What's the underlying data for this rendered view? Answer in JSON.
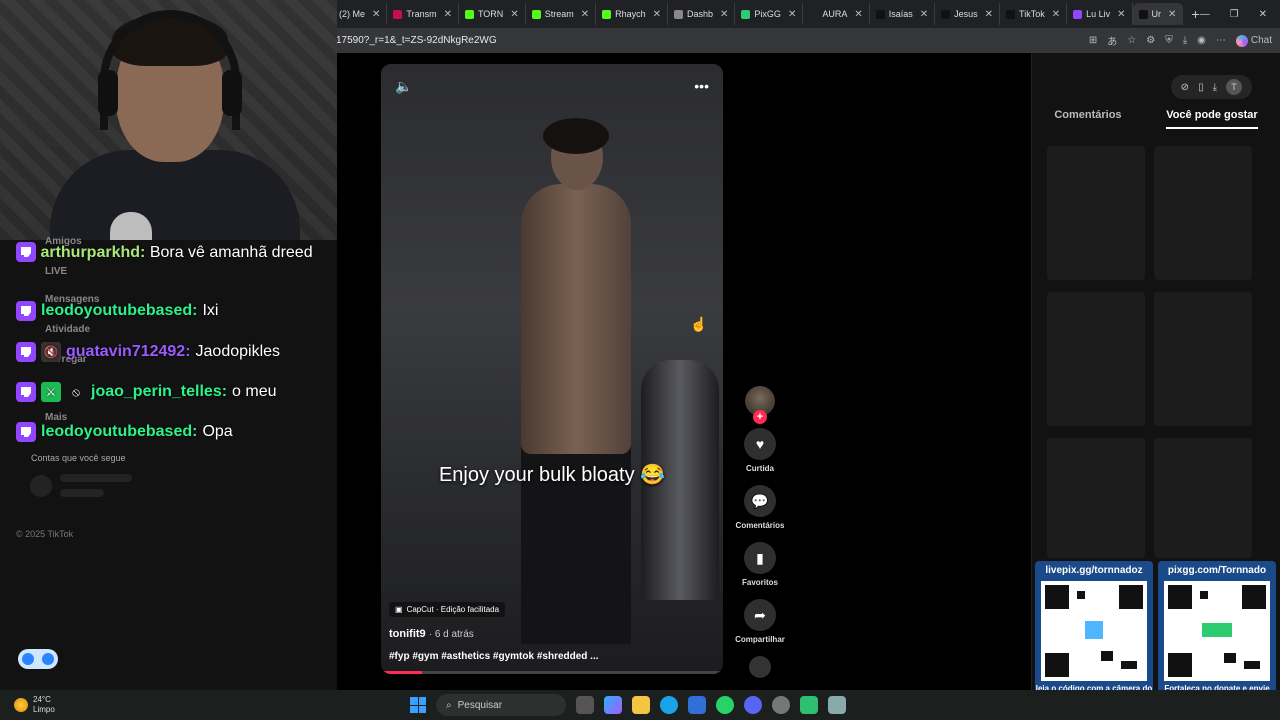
{
  "browser": {
    "tabs": [
      {
        "label": "(2) Me",
        "color": "#ff0000"
      },
      {
        "label": "Transm",
        "color": "#c4104a"
      },
      {
        "label": "TORN",
        "color": "#53fc18"
      },
      {
        "label": "Stream",
        "color": "#53fc18"
      },
      {
        "label": "Rhaych",
        "color": "#53fc18"
      },
      {
        "label": "Dashb",
        "color": "#888888"
      },
      {
        "label": "PixGG",
        "color": "#2ecc71"
      },
      {
        "label": "AURA",
        "color": "#222222"
      },
      {
        "label": "Isaías",
        "color": "#111111"
      },
      {
        "label": "Jesus",
        "color": "#111111"
      },
      {
        "label": "TikTok",
        "color": "#111111"
      },
      {
        "label": "Lu Liv",
        "color": "#9146ff"
      },
      {
        "label": "Ur",
        "color": "#111111"
      }
    ],
    "url": "17590?_r=1&_t=ZS-92dNkgRe2WG",
    "chat_label": "Chat"
  },
  "sidebar": {
    "items": [
      "Amigos",
      "LIVE",
      "Mensagens",
      "Atividade",
      "Carregar",
      "Mais"
    ],
    "following_label": "Contas que você segue",
    "copyright": "© 2025 TikTok"
  },
  "chat": [
    {
      "user": "arthurparkhd",
      "text": "Bora vê amanhã dreed",
      "color": "#a8e87a"
    },
    {
      "user": "leodoyoutubebased",
      "text": "Ixi",
      "color": "#2cf28a"
    },
    {
      "user": "guatavin712492",
      "text": "Jaodopikles",
      "color": "#9a5cff"
    },
    {
      "user": "joao_perin_telles",
      "text": "o meu",
      "color": "#2cf28a"
    },
    {
      "user": "leodoyoutubebased",
      "text": "Opa",
      "color": "#2cf28a"
    }
  ],
  "video": {
    "caption": "Enjoy your bulk bloaty 😂",
    "capcut_label": "CapCut · Edição facilitada",
    "author": "tonifit9",
    "when": "· 6 d atrás",
    "hashtags": "#fyp #gym #asthetics #gymtok #shredded ...",
    "progress": 0.12
  },
  "actions": {
    "like": "Curtida",
    "comments": "Comentários",
    "favorites": "Favoritos",
    "share": "Compartilhar"
  },
  "right_panel": {
    "tab_comments": "Comentários",
    "tab_suggested": "Você pode gostar",
    "user_initial": "T"
  },
  "qr": [
    {
      "title": "livepix.gg/tornnadoz",
      "bottom": "leia o código com a câmera do celular."
    },
    {
      "title": "pixgg.com/Tornnado",
      "bottom": "Fortaleça no donate e envie sua mensagem!"
    }
  ],
  "taskbar": {
    "temperature": "24°C",
    "condition": "Limpo",
    "search": "Pesquisar"
  }
}
